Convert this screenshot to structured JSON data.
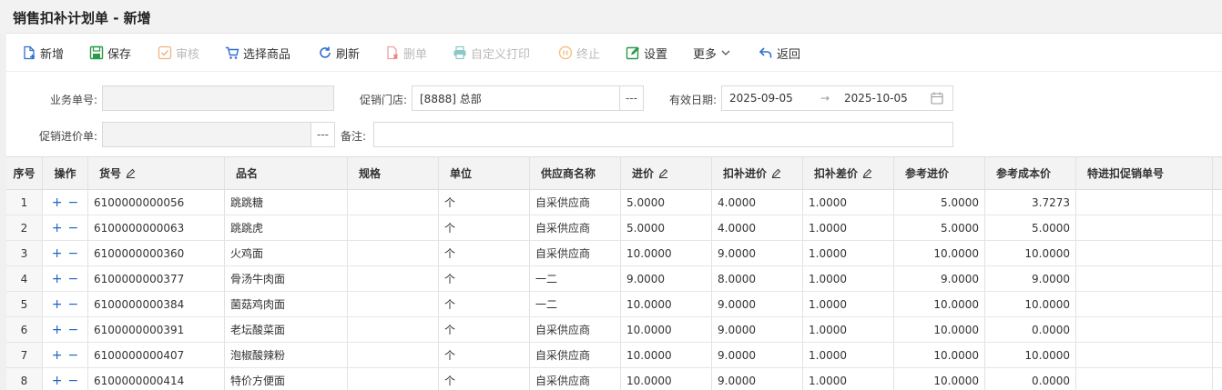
{
  "title": "销售扣补计划单 - 新增",
  "toolbar": {
    "new": "新增",
    "save": "保存",
    "review": "审核",
    "select_goods": "选择商品",
    "refresh": "刷新",
    "delete": "删单",
    "custom_print": "自定义打印",
    "terminate": "终止",
    "settings": "设置",
    "more": "更多",
    "back": "返回"
  },
  "form": {
    "doc_no_label": "业务单号:",
    "doc_no_value": "",
    "store_label": "促销门店:",
    "store_value": "[8888] 总部",
    "date_label": "有效日期:",
    "date_start": "2025-09-05",
    "date_sep": "→",
    "date_end": "2025-10-05",
    "promo_price_label": "促销进价单:",
    "promo_price_value": "",
    "remark_label": "备注:",
    "remark_value": "",
    "ellipsis": "---"
  },
  "columns": [
    "序号",
    "操作",
    "货号",
    "品名",
    "规格",
    "单位",
    "供应商名称",
    "进价",
    "扣补进价",
    "扣补差价",
    "参考进价",
    "参考成本价",
    "特进扣促销单号"
  ],
  "ops": {
    "add": "+",
    "remove": "−"
  },
  "rows": [
    {
      "idx": "1",
      "code": "6100000000056",
      "name": "跳跳糖",
      "spec": "",
      "unit": "个",
      "supplier": "自采供应商",
      "price": "5.0000",
      "sub_price": "4.0000",
      "sub_diff": "1.0000",
      "ref_price": "5.0000",
      "ref_cost": "3.7273",
      "promo_no": ""
    },
    {
      "idx": "2",
      "code": "6100000000063",
      "name": "跳跳虎",
      "spec": "",
      "unit": "个",
      "supplier": "自采供应商",
      "price": "5.0000",
      "sub_price": "4.0000",
      "sub_diff": "1.0000",
      "ref_price": "5.0000",
      "ref_cost": "5.0000",
      "promo_no": ""
    },
    {
      "idx": "3",
      "code": "6100000000360",
      "name": "火鸡面",
      "spec": "",
      "unit": "个",
      "supplier": "自采供应商",
      "price": "10.0000",
      "sub_price": "9.0000",
      "sub_diff": "1.0000",
      "ref_price": "10.0000",
      "ref_cost": "10.0000",
      "promo_no": ""
    },
    {
      "idx": "4",
      "code": "6100000000377",
      "name": "骨汤牛肉面",
      "spec": "",
      "unit": "个",
      "supplier": "一二",
      "price": "9.0000",
      "sub_price": "8.0000",
      "sub_diff": "1.0000",
      "ref_price": "9.0000",
      "ref_cost": "9.0000",
      "promo_no": ""
    },
    {
      "idx": "5",
      "code": "6100000000384",
      "name": "菌菇鸡肉面",
      "spec": "",
      "unit": "个",
      "supplier": "一二",
      "price": "10.0000",
      "sub_price": "9.0000",
      "sub_diff": "1.0000",
      "ref_price": "10.0000",
      "ref_cost": "10.0000",
      "promo_no": ""
    },
    {
      "idx": "6",
      "code": "6100000000391",
      "name": "老坛酸菜面",
      "spec": "",
      "unit": "个",
      "supplier": "自采供应商",
      "price": "10.0000",
      "sub_price": "9.0000",
      "sub_diff": "1.0000",
      "ref_price": "10.0000",
      "ref_cost": "0.0000",
      "promo_no": ""
    },
    {
      "idx": "7",
      "code": "6100000000407",
      "name": "泡椒酸辣粉",
      "spec": "",
      "unit": "个",
      "supplier": "自采供应商",
      "price": "10.0000",
      "sub_price": "9.0000",
      "sub_diff": "1.0000",
      "ref_price": "10.0000",
      "ref_cost": "10.0000",
      "promo_no": ""
    },
    {
      "idx": "8",
      "code": "6100000000414",
      "name": "特价方便面",
      "spec": "",
      "unit": "个",
      "supplier": "自采供应商",
      "price": "10.0000",
      "sub_price": "9.0000",
      "sub_diff": "1.0000",
      "ref_price": "10.0000",
      "ref_cost": "0.0000",
      "promo_no": ""
    }
  ]
}
